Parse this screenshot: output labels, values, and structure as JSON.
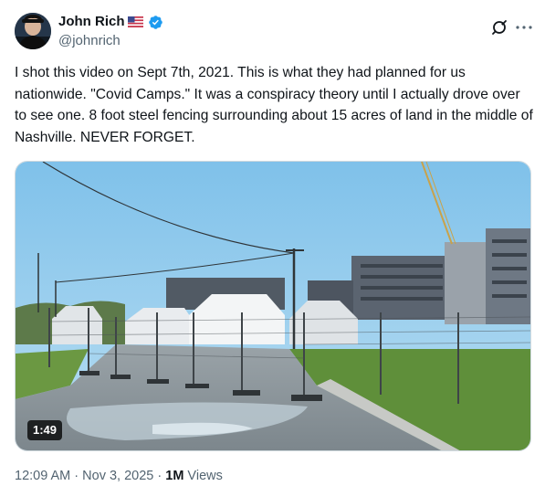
{
  "author": {
    "name": "John Rich",
    "handle": "@johnrich",
    "flag_icon": "us-flag-emoji",
    "verified_icon": "verified-badge-icon",
    "verified_color": "#1d9bf0"
  },
  "tweet": {
    "text": "I shot this video on Sept 7th, 2021. This is what they had planned for us nationwide. \"Covid Camps.\" It was a conspiracy theory until I actually drove over to see one. 8 foot steel fencing surrounding about 15 acres of land in the middle of Nashville. NEVER FORGET."
  },
  "media": {
    "type": "video",
    "duration": "1:49"
  },
  "meta": {
    "time": "12:09 AM",
    "separator1": " · ",
    "date": "Nov 3, 2025",
    "separator2": " · ",
    "views_count": "1M",
    "views_label": " Views"
  },
  "colors": {
    "secondary_text": "#536471",
    "primary_text": "#0f1419"
  }
}
